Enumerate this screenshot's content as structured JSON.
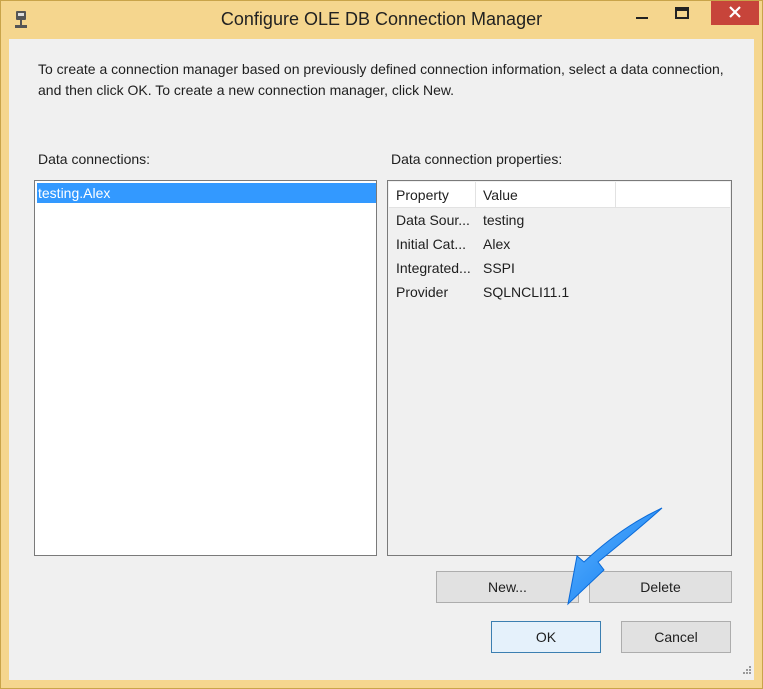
{
  "window": {
    "title": "Configure OLE DB Connection Manager"
  },
  "instructions": "To create a connection manager based on previously defined connection information, select a data connection, and then click OK. To create a new connection manager, click New.",
  "connections": {
    "label": "Data connections:",
    "items": [
      "testing.Alex"
    ],
    "selected": "testing.Alex"
  },
  "properties": {
    "label": "Data connection properties:",
    "columns": [
      "Property",
      "Value"
    ],
    "rows": [
      {
        "property": "Data Sour...",
        "value": "testing"
      },
      {
        "property": "Initial Cat...",
        "value": "Alex"
      },
      {
        "property": "Integrated...",
        "value": "SSPI"
      },
      {
        "property": "Provider",
        "value": "SQLNCLI11.1"
      }
    ]
  },
  "buttons": {
    "new": "New...",
    "delete": "Delete",
    "ok": "OK",
    "cancel": "Cancel"
  },
  "colors": {
    "title_bar": "#f5d68e",
    "close_button": "#c7443a",
    "selection": "#3399ff",
    "annotation_arrow": "#1a8cff"
  },
  "icons": {
    "app": "connection-manager-icon",
    "minimize": "minimize-icon",
    "maximize": "maximize-icon",
    "close": "close-icon",
    "annotation": "blue-arrow-annotation"
  }
}
